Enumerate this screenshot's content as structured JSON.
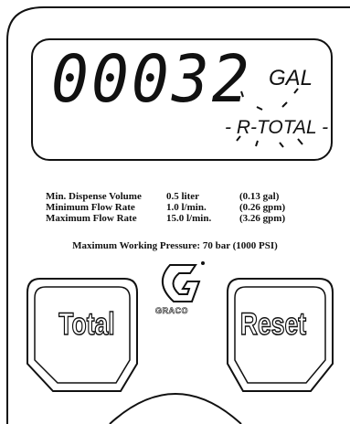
{
  "display": {
    "reading": "00032",
    "unit": "GAL",
    "mode": "- R-TOTAL -"
  },
  "specs": [
    {
      "label": "Min. Dispense Volume",
      "metric": "0.5 liter",
      "imperial": "(0.13 gal)"
    },
    {
      "label": "Minimum Flow Rate",
      "metric": "1.0 l/min.",
      "imperial": "(0.26 gpm)"
    },
    {
      "label": "Maximum Flow Rate",
      "metric": "15.0 l/min.",
      "imperial": "(3.26 gpm)"
    }
  ],
  "pressure_note": "Maximum Working Pressure: 70 bar (1000 PSI)",
  "brand": "GRACO",
  "buttons": {
    "total_label": "Total",
    "reset_label": "Reset"
  },
  "colors": {
    "outline": "#111111",
    "background": "#ffffff"
  }
}
